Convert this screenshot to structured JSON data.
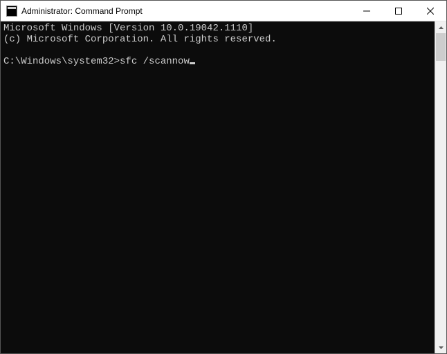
{
  "window": {
    "title": "Administrator: Command Prompt",
    "icon_name": "cmd-prompt-icon"
  },
  "console": {
    "line1": "Microsoft Windows [Version 10.0.19042.1110]",
    "line2": "(c) Microsoft Corporation. All rights reserved.",
    "blank": "",
    "prompt": "C:\\Windows\\system32>",
    "command": "sfc /scannow"
  },
  "controls": {
    "minimize": "minimize",
    "maximize": "maximize",
    "close": "close"
  }
}
